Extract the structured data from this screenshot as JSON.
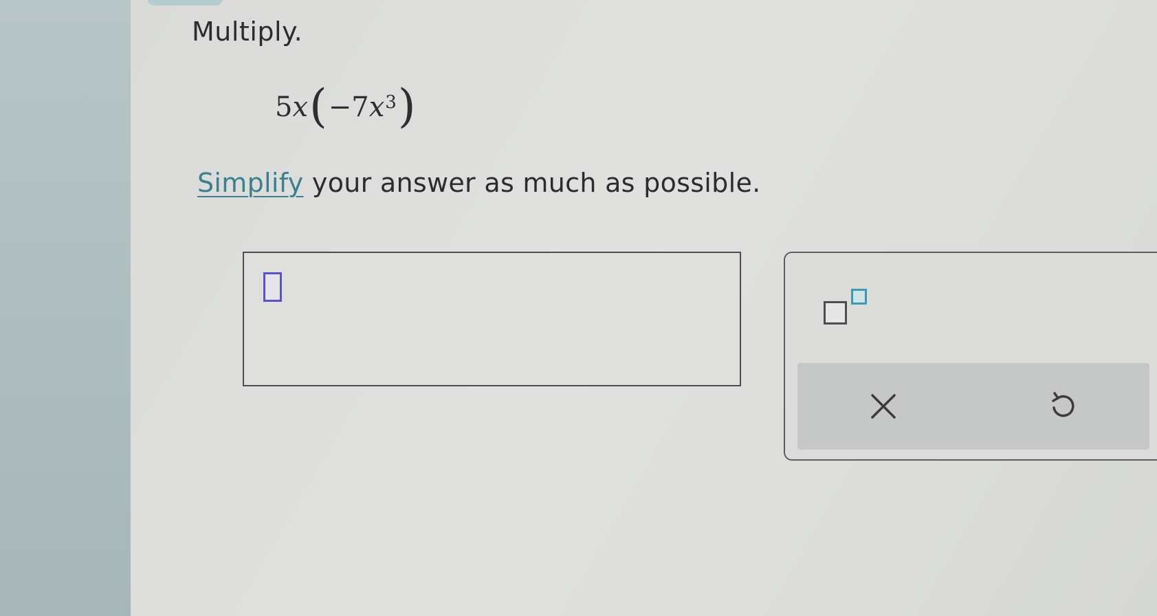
{
  "question": {
    "instruction": "Multiply.",
    "expression": {
      "coefficient": "5",
      "variable": "x",
      "open_paren": "(",
      "inner_sign_coefficient": "−7",
      "inner_variable": "x",
      "inner_exponent": "3",
      "close_paren": ")"
    },
    "directions": {
      "link_text": "Simplify",
      "rest": " your answer as much as possible."
    }
  },
  "answer": {
    "value": ""
  },
  "keypad": {
    "exponent_icon": "exponent-template-icon",
    "clear_icon": "close-x-icon",
    "undo_icon": "undo-icon",
    "accent_color": "#3a9ab0",
    "cursor_color": "#5a52c9"
  }
}
